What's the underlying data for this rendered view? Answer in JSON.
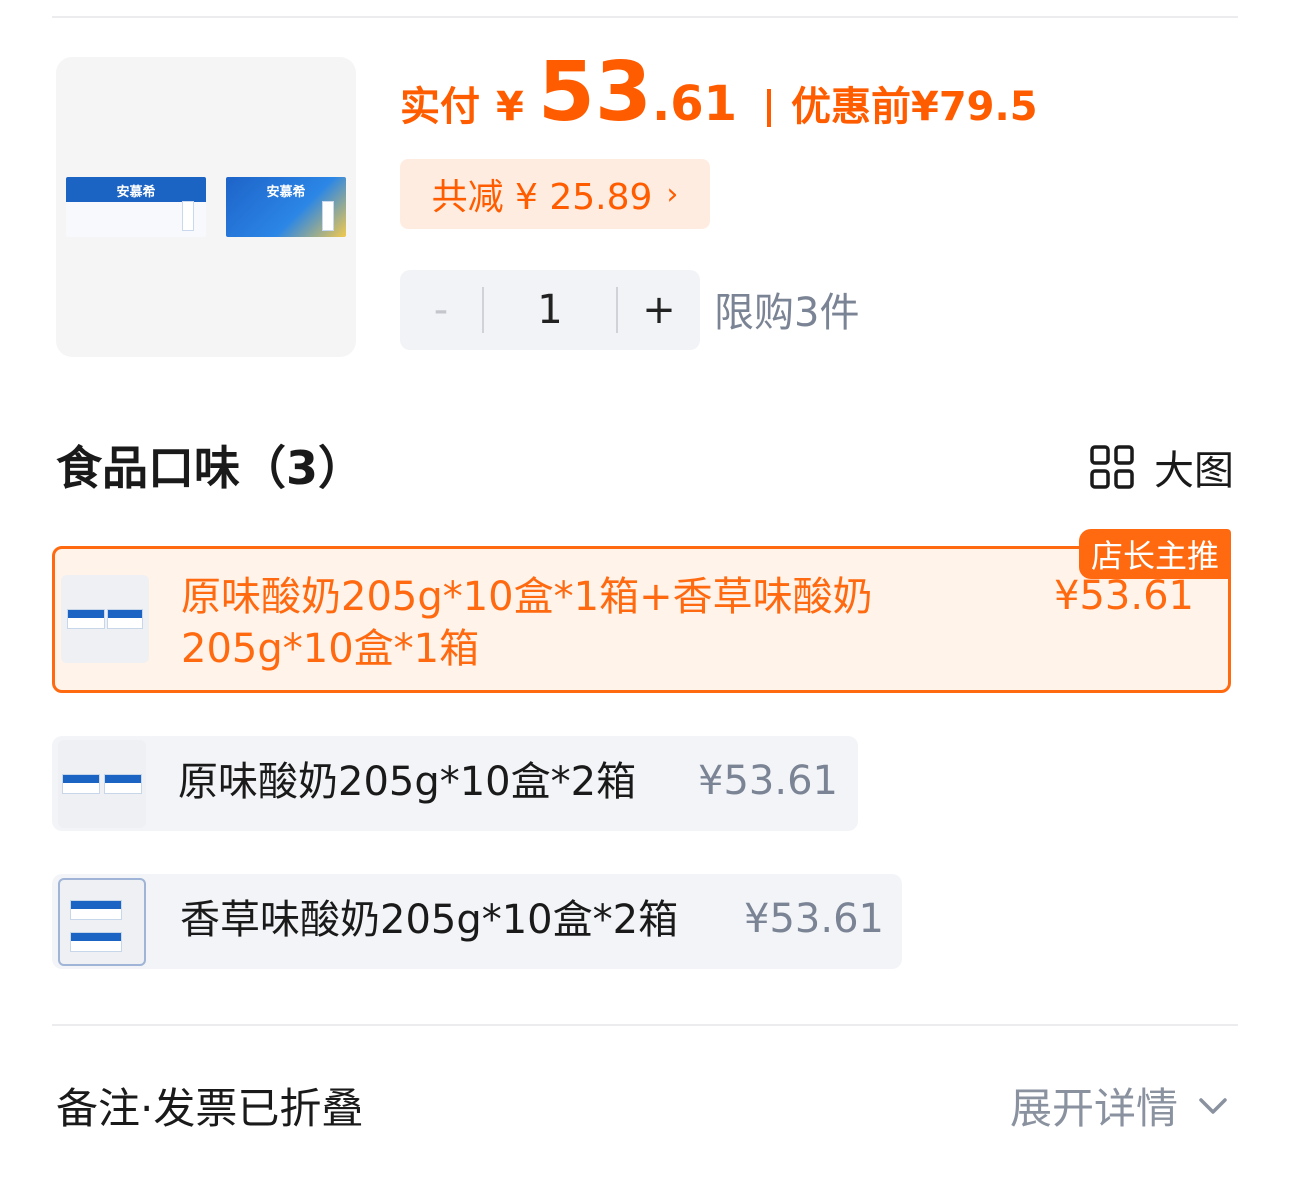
{
  "product": {
    "paid_label": "实付",
    "currency": "¥",
    "price_int": "53",
    "price_dec": ".61",
    "original_label": "优惠前",
    "original_price": "¥79.5",
    "discount_text": "共减 ¥ 25.89",
    "image_brand": "安慕希",
    "quantity": {
      "minus": "-",
      "value": "1",
      "plus": "+"
    },
    "limit_text": "限购3件"
  },
  "section": {
    "title": "食品口味（3）",
    "view_label": "大图"
  },
  "options": [
    {
      "name": "原味酸奶205g*10盒*1箱+香草味酸奶205g*10盒*1箱",
      "price": "¥53.61",
      "badge": "店长主推",
      "selected": true
    },
    {
      "name": "原味酸奶205g*10盒*2箱",
      "price": "¥53.61",
      "selected": false
    },
    {
      "name": "香草味酸奶205g*10盒*2箱",
      "price": "¥53.61",
      "selected": false
    }
  ],
  "footer": {
    "label": "备注·发票已折叠",
    "action": "展开详情"
  },
  "colors": {
    "accent": "#ff5c00",
    "selected_bg": "#fff3ea",
    "muted_text": "#7b8495",
    "option_bg": "#f2f4f7"
  },
  "icons": [
    "grid-view-icon",
    "chevron-right-icon",
    "chevron-down-icon"
  ]
}
